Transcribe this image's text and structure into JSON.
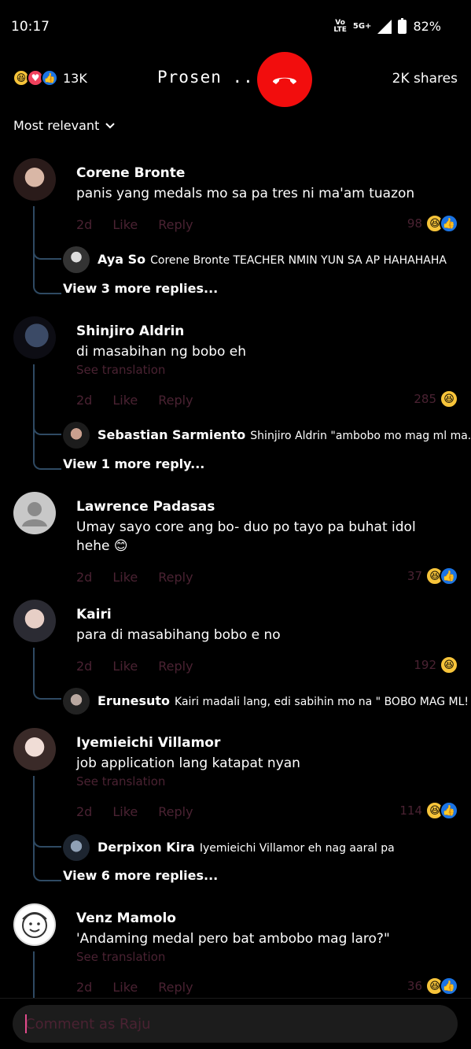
{
  "status": {
    "time": "10:17",
    "volte": "Vo\nLTE",
    "network": "5G+",
    "battery": "82%"
  },
  "header": {
    "reaction_count": "13K",
    "title": "Prosen ...",
    "shares": "2K shares"
  },
  "sort": {
    "label": "Most relevant"
  },
  "comments": [
    {
      "author": "Corene Bronte",
      "text": "panis yang medals mo sa pa tres ni ma'am tuazon",
      "time": "2d",
      "like": "Like",
      "reply": "Reply",
      "count": "98",
      "reply_preview": {
        "author": "Aya So",
        "text": "Corene Bronte TEACHER NMIN YUN SA AP HAHAHAHA"
      },
      "view_more": "View 3 more replies..."
    },
    {
      "author": "Shinjiro Aldrin",
      "text": "di masabihan ng bobo eh",
      "see_translation": "See translation",
      "time": "2d",
      "like": "Like",
      "reply": "Reply",
      "count": "285",
      "reply_preview": {
        "author": "Sebastian Sarmiento",
        "text": "Shinjiro Aldrin \"ambobo mo mag ml ma..."
      },
      "view_more": "View 1 more reply..."
    },
    {
      "author": "Lawrence Padasas",
      "text": "Umay sayo core ang bo- duo po tayo pa buhat idol hehe 😊",
      "time": "2d",
      "like": "Like",
      "reply": "Reply",
      "count": "37"
    },
    {
      "author": "Kairi",
      "text": "para di masabihang bobo e no",
      "time": "2d",
      "like": "Like",
      "reply": "Reply",
      "count": "192",
      "reply_preview": {
        "author": "Erunesuto",
        "text": "Kairi madali lang, edi sabihin mo na \" BOBO MAG ML! \""
      }
    },
    {
      "author": "Iyemieichi Villamor",
      "text": "job application lang katapat nyan",
      "see_translation": "See translation",
      "time": "2d",
      "like": "Like",
      "reply": "Reply",
      "count": "114",
      "reply_preview": {
        "author": "Derpixon Kira",
        "text": "Iyemieichi Villamor eh nag aaral pa"
      },
      "view_more": "View 6 more replies..."
    },
    {
      "author": "Venz Mamolo",
      "text": "'Andaming medal pero bat ambobo mag laro?\"",
      "see_translation": "See translation",
      "time": "2d",
      "like": "Like",
      "reply": "Reply",
      "count": "36"
    }
  ],
  "composer": {
    "placeholder": "Comment as Raju"
  },
  "colors": {
    "end_call": "#f20d0d",
    "muted_text": "#4a2232",
    "thread_line": "#2f4a63",
    "like_blue": "#1b74e4",
    "haha_yellow": "#f7c43a"
  }
}
